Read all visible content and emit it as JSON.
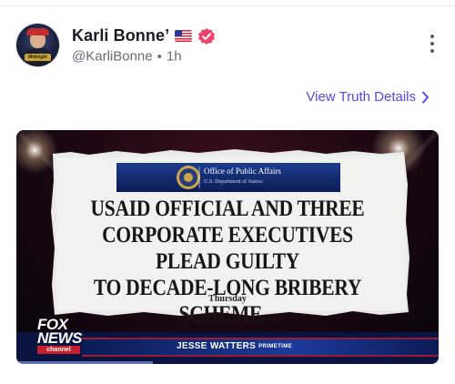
{
  "post": {
    "author": {
      "display_name": "Karli Bonne’",
      "handle": "@KarliBonne",
      "separator": "•",
      "time": "1h",
      "avatar_badge_text": "Midnight Rider"
    },
    "view_details_label": "View Truth Details",
    "media": {
      "office_title": "Office of Public Affairs",
      "office_subtitle": "U.S. Department of Justice",
      "headline_lines": [
        "USAID OFFICIAL AND THREE",
        "CORPORATE EXECUTIVES PLEAD GUILTY",
        "TO DECADE-LONG BRIBERY SCHEME..."
      ],
      "day": "Thursday",
      "network_logo_top": "FOX",
      "network_logo_mid": "NEWS",
      "network_logo_bottom": "channel",
      "show_title": "JESSE WATTERS",
      "show_subtitle": "PRIMETIME"
    }
  },
  "icons": {
    "flag": "us-flag-icon",
    "verified": "verified-badge-icon",
    "more": "more-vertical-icon",
    "chevron": "chevron-right-icon"
  },
  "colors": {
    "accent": "#5448ee",
    "verified": "#f0426b",
    "muted_text": "#6b6b78"
  }
}
